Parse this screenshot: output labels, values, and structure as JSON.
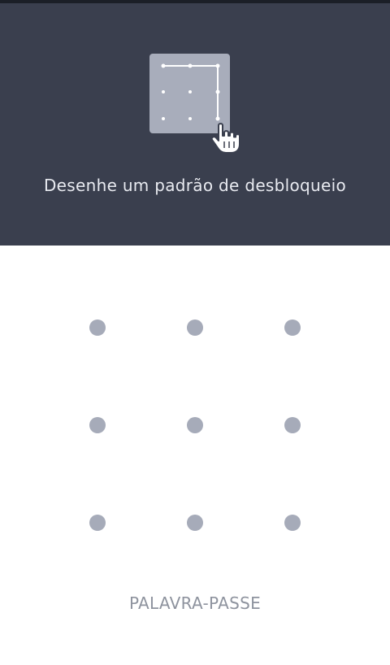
{
  "header": {
    "instruction": "Desenhe um padrão de desbloqueio",
    "illustration_icon": "pattern-lock-icon",
    "pointer_icon": "hand-pointer-icon"
  },
  "pattern_grid": {
    "rows": 3,
    "columns": 3,
    "dot_color": "#a6abb9"
  },
  "footer": {
    "password_label": "PALAVRA-PASSE"
  },
  "colors": {
    "header_background": "#3a3f4e",
    "illustration_background": "#a8adbb",
    "instruction_text": "#e8eaf0",
    "button_text": "#8e939e"
  }
}
